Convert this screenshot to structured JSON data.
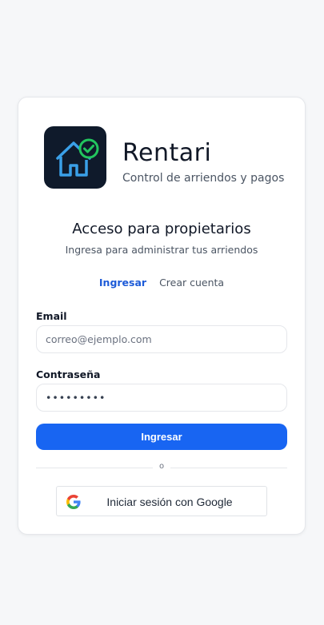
{
  "brand": {
    "name": "Rentari",
    "tagline": "Control de arriendos y pagos",
    "logo_icon": "house-check-icon"
  },
  "auth": {
    "heading": "Acceso para propietarios",
    "subheading": "Ingresa para administrar tus arriendos",
    "tabs": [
      {
        "label": "Ingresar",
        "active": true
      },
      {
        "label": "Crear cuenta",
        "active": false
      }
    ],
    "email": {
      "label": "Email",
      "placeholder": "correo@ejemplo.com",
      "value": ""
    },
    "password": {
      "label": "Contraseña",
      "value": "secret123"
    },
    "submit_label": "Ingresar",
    "divider_text": "o",
    "google_label": "Iniciar sesión con Google"
  },
  "colors": {
    "primary": "#1865f2",
    "logo_bg": "#0f1a2b",
    "house_blue": "#3aa0e8",
    "check_green": "#22c55e"
  }
}
